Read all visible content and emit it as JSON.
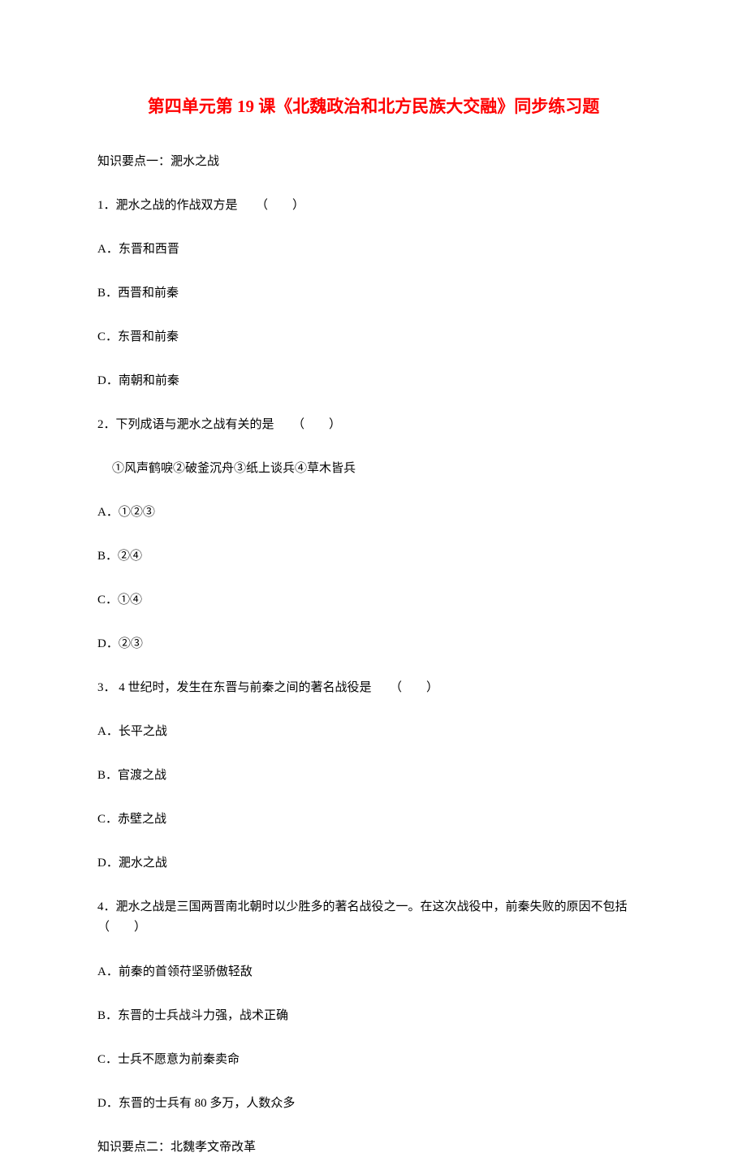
{
  "title": "第四单元第 19 课《北魏政治和北方民族大交融》同步练习题",
  "section1": "知识要点一：淝水之战",
  "q1": {
    "text": "1．淝水之战的作战双方是　　（　　）",
    "a": "A．东晋和西晋",
    "b": "B．西晋和前秦",
    "c": "C．东晋和前秦",
    "d": "D．南朝和前秦"
  },
  "q2": {
    "text": "2．下列成语与淝水之战有关的是　　（　　）",
    "sub": "①风声鹤唳②破釜沉舟③纸上谈兵④草木皆兵",
    "a": "A．①②③",
    "b": "B．②④",
    "c": "C．①④",
    "d": "D．②③"
  },
  "q3": {
    "text": "3．  4 世纪时，发生在东晋与前秦之间的著名战役是　　（　　）",
    "a": "A．长平之战",
    "b": "B．官渡之战",
    "c": "C．赤壁之战",
    "d": "D．淝水之战"
  },
  "q4": {
    "text": "4．淝水之战是三国两晋南北朝时以少胜多的著名战役之一。在这次战役中，前秦失败的原因不包括　　（　　）",
    "a": "A．前秦的首领苻坚骄傲轻敌",
    "b": "B．东晋的士兵战斗力强，战术正确",
    "c": "C．士兵不愿意为前秦卖命",
    "d": "D．东晋的士兵有 80 多万，人数众多"
  },
  "section2": "知识要点二：北魏孝文帝改革"
}
